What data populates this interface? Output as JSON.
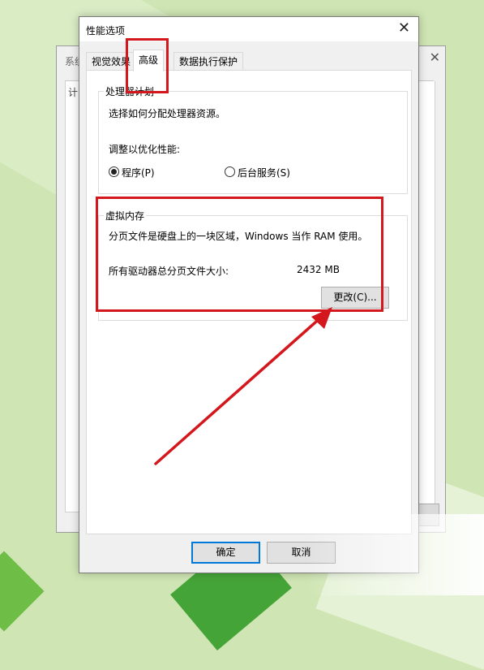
{
  "back_window": {
    "title": "系统",
    "tab_fragment": "计"
  },
  "dialog": {
    "title": "性能选项",
    "tabs": [
      {
        "label": "视觉效果"
      },
      {
        "label": "高级"
      },
      {
        "label": "数据执行保护"
      }
    ],
    "processor": {
      "legend": "处理器计划",
      "desc": "选择如何分配处理器资源。",
      "adjust_label": "调整以优化性能:",
      "option_programs": "程序(P)",
      "option_services": "后台服务(S)"
    },
    "virtual_memory": {
      "legend": "虚拟内存",
      "desc": "分页文件是硬盘上的一块区域，Windows 当作 RAM 使用。",
      "total_label": "所有驱动器总分页文件大小:",
      "total_value": "2432 MB",
      "change_button": "更改(C)..."
    },
    "ok_button": "确定",
    "cancel_button": "取消"
  },
  "colors": {
    "highlight": "#d4161d",
    "accent": "#0078d7"
  }
}
